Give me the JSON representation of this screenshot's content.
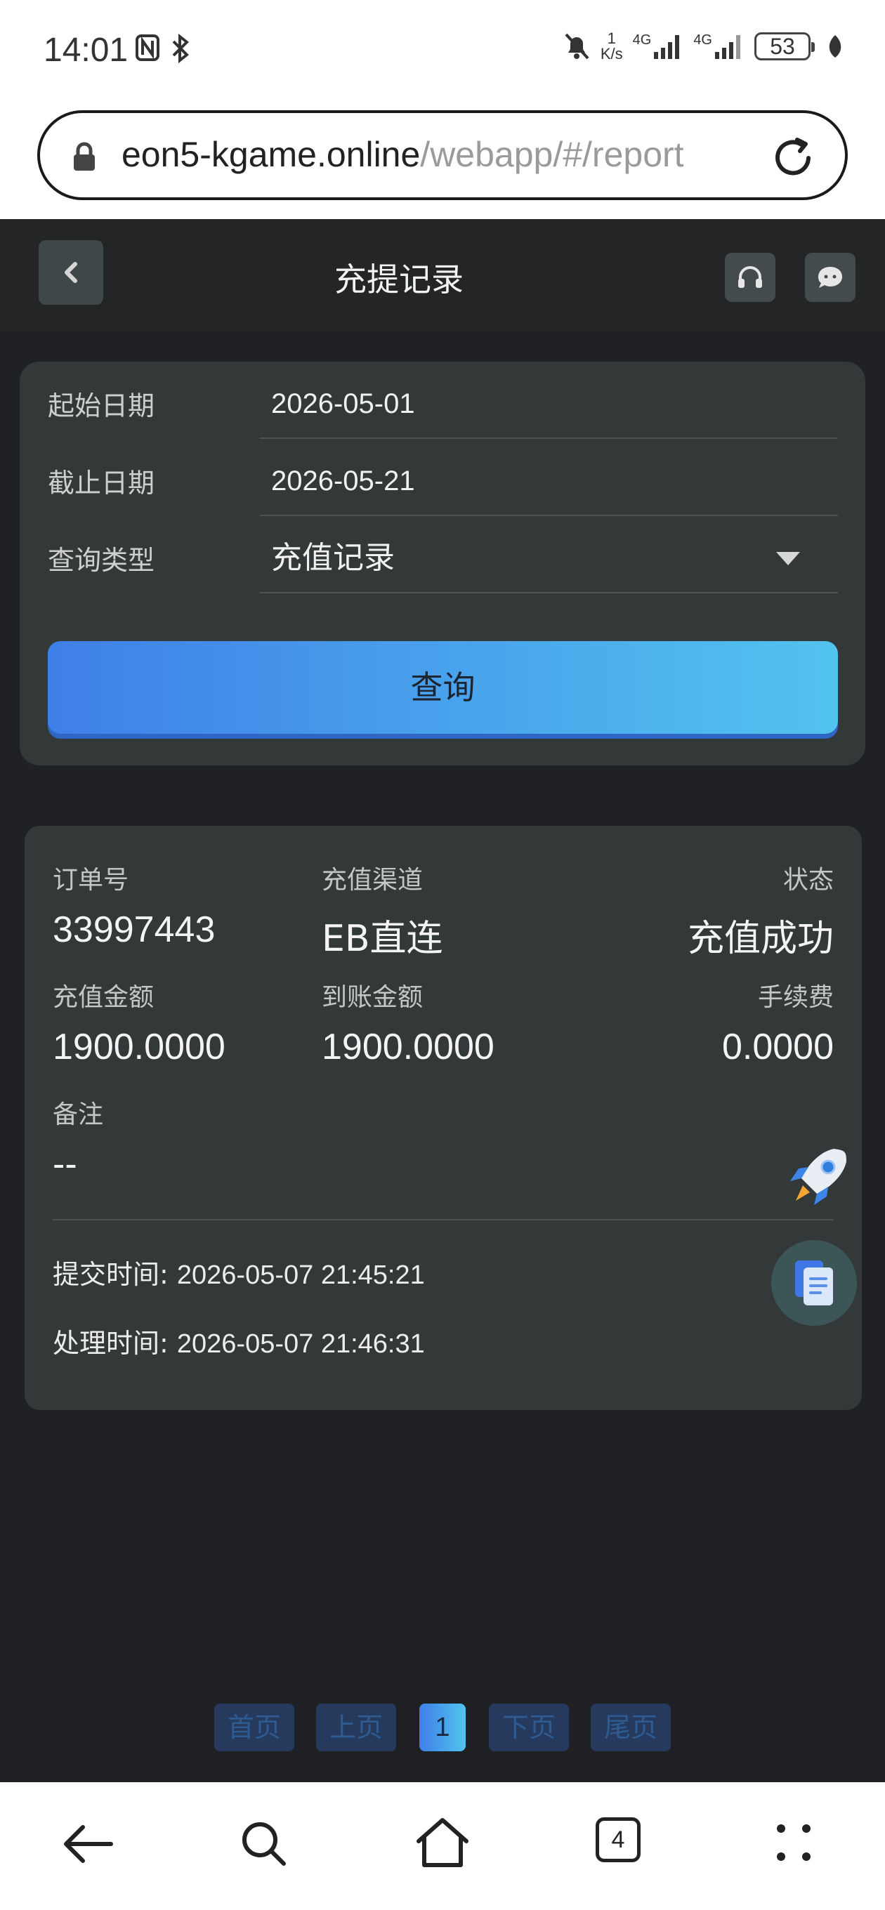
{
  "status_bar": {
    "time": "14:01",
    "net_speed_value": "1",
    "net_speed_unit": "K/s",
    "signal_1": "4G",
    "signal_2": "4G",
    "battery": "53"
  },
  "browser": {
    "url_host": "eon5-kgame.online",
    "url_path": "/webapp/#/report"
  },
  "header": {
    "title": "充提记录"
  },
  "filter": {
    "start_label": "起始日期",
    "start_value": "2026-05-01",
    "end_label": "截止日期",
    "end_value": "2026-05-21",
    "type_label": "查询类型",
    "type_value": "充值记录",
    "query_button": "查询"
  },
  "record": {
    "order_label": "订单号",
    "order_value": "33997443",
    "channel_label": "充值渠道",
    "channel_value": "EB直连",
    "status_label": "状态",
    "status_value": "充值成功",
    "amount_label": "充值金额",
    "amount_value": "1900.0000",
    "credited_label": "到账金额",
    "credited_value": "1900.0000",
    "fee_label": "手续费",
    "fee_value": "0.0000",
    "remark_label": "备注",
    "remark_value": "--",
    "submit_label": "提交时间: ",
    "submit_value": "2026-05-07 21:45:21",
    "process_label": "处理时间: ",
    "process_value": "2026-05-07 21:46:31"
  },
  "pagination": {
    "first": "首页",
    "prev": "上页",
    "current": "1",
    "next": "下页",
    "last": "尾页"
  },
  "navbar": {
    "tabs_count": "4"
  }
}
